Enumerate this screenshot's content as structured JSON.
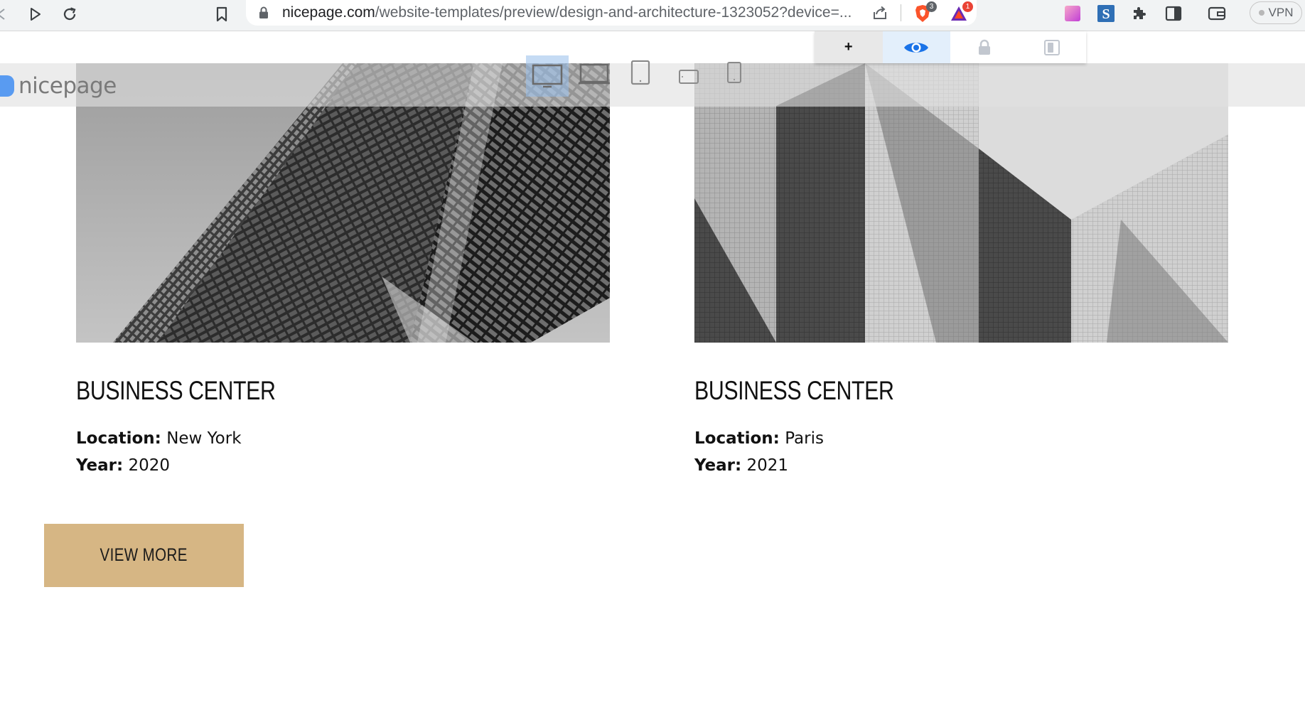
{
  "browser": {
    "url_host": "nicepage.com",
    "url_path": "/website-templates/preview/design-and-architecture-1323052?device=...",
    "extensions": [
      {
        "name": "brave-shields",
        "badge": "3"
      },
      {
        "name": "brave-rewards",
        "badge": "1"
      }
    ],
    "vpn_label": "VPN"
  },
  "overlay": {
    "logo_text": "nicepage",
    "panel_add_label": "+"
  },
  "cards": [
    {
      "title": "BUSINESS CENTER",
      "location_label": "Location:",
      "location_value": "New York",
      "year_label": "Year:",
      "year_value": "2020"
    },
    {
      "title": "BUSINESS CENTER",
      "location_label": "Location:",
      "location_value": "Paris",
      "year_label": "Year:",
      "year_value": "2021"
    }
  ],
  "cta": {
    "label": "VIEW MORE"
  },
  "colors": {
    "cta_background": "#d6b684",
    "overlay_accent": "#1a73e8",
    "logo_mark": "#3f8df2"
  }
}
